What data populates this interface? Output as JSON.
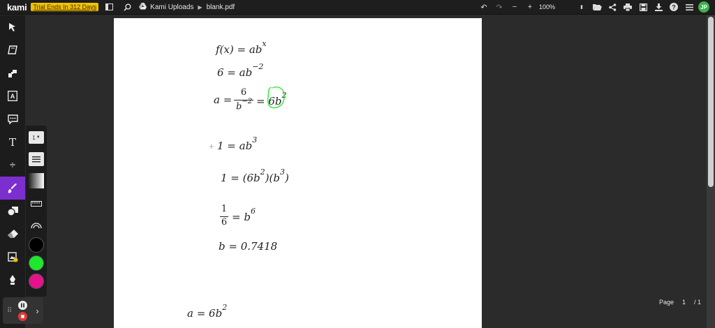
{
  "app": {
    "logo": "kami",
    "trial": "Trial Ends In 312 Days"
  },
  "breadcrumb": {
    "folder": "Kami Uploads",
    "file": "blank.pdf"
  },
  "toolbar": {
    "zoom": "100%",
    "avatar": "JP"
  },
  "colors": {
    "accent": "#7d2ecf",
    "black": "#000000",
    "green": "#1ee82e",
    "pink": "#e6128b"
  },
  "palette": {
    "stroke_size": "1"
  },
  "equations": {
    "line1": "f(x) = ab",
    "line1_sup": "x",
    "line2": "6 = ab",
    "line2_sup": "−2",
    "line3_lhs": "a =",
    "line3_num": "6",
    "line3_den": "b",
    "line3_den_sup": "−2",
    "line3_rhs": "= 6b",
    "line3_rhs_sup": "2",
    "line4": "1 = ab",
    "line4_sup": "3",
    "line5_a": "1 = (6b",
    "line5_a_sup": "2",
    "line5_b": ")(b",
    "line5_b_sup": "3",
    "line5_c": ")",
    "line6_num": "1",
    "line6_den": "6",
    "line6_rhs": "= b",
    "line6_rhs_sup": "6",
    "line7": "b = 0.7418",
    "line8": "a = 6b",
    "line8_sup": "2"
  },
  "pager": {
    "label": "Page",
    "current": "1",
    "total": "/ 1"
  }
}
